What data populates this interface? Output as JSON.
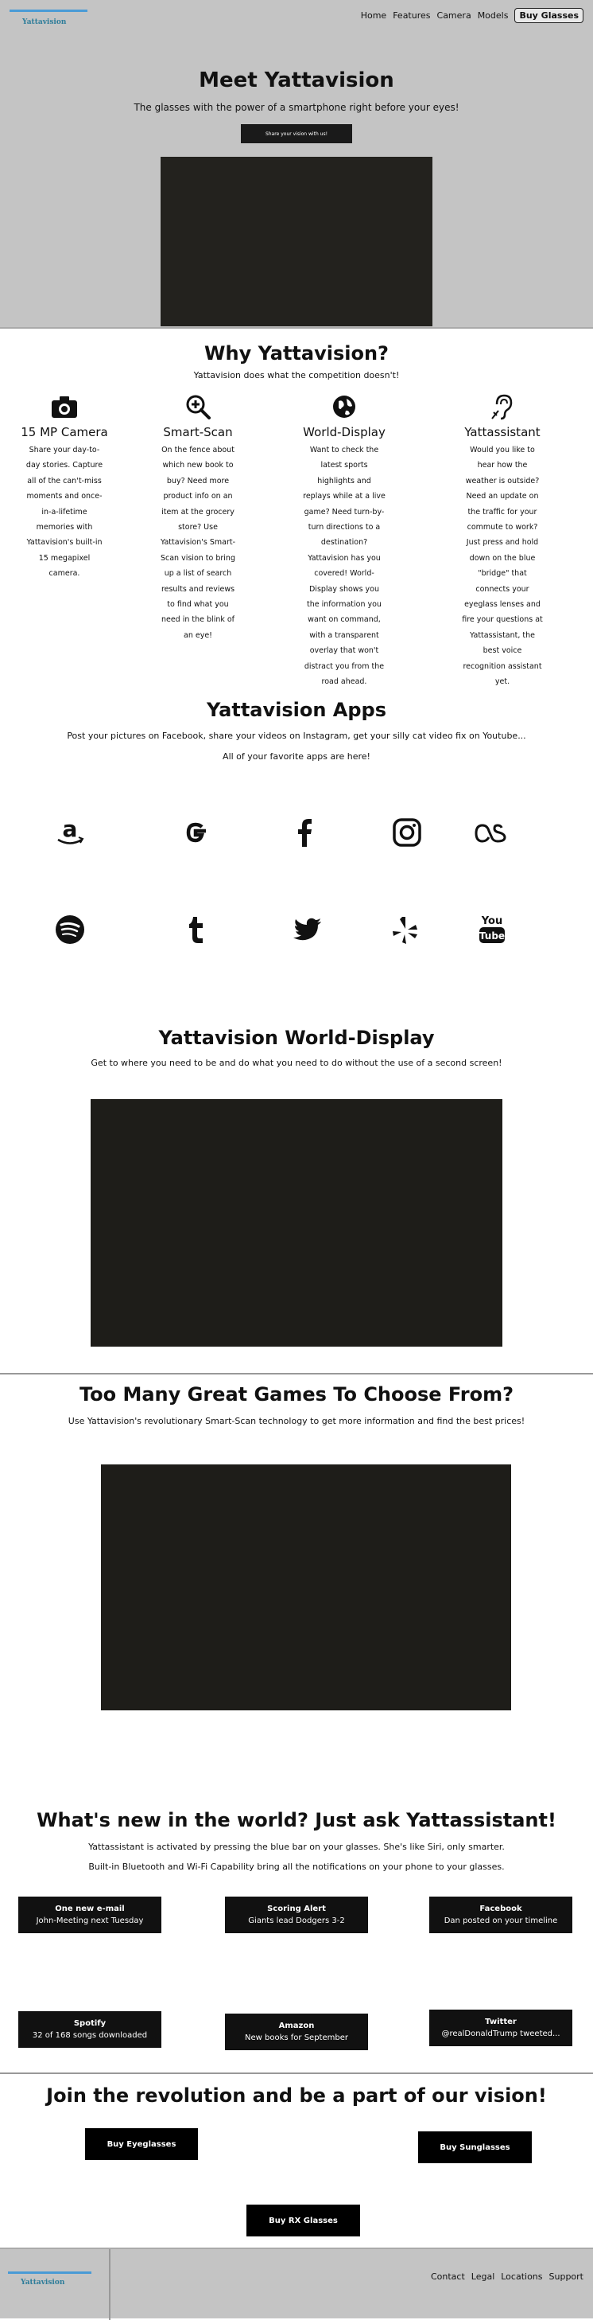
{
  "header": {
    "logo_text": "Yattavision",
    "nav": [
      "Home",
      "Features",
      "Camera",
      "Models"
    ],
    "buy_label": "Buy Glasses"
  },
  "hero": {
    "title": "Meet Yattavision",
    "subtitle": "The glasses with the power of a smartphone right before your eyes!",
    "button_label": "Share your vision with us!"
  },
  "why": {
    "title": "Why Yattavision?",
    "subtitle": "Yattavision does what the competition doesn't!",
    "features": [
      {
        "icon": "camera-icon",
        "name": "15 MP Camera",
        "desc": "Share your day-to-day stories. Capture all of the can't-miss moments and once-in-a-lifetime memories with Yattavision's built-in 15 megapixel camera."
      },
      {
        "icon": "magnifier-plus-icon",
        "name": "Smart-Scan",
        "desc": "On the fence about which new book to buy? Need more product info on an item at the grocery store? Use Yattavision's Smart-Scan vision to bring up a list of search results and reviews to find what you need in the blink of an eye!"
      },
      {
        "icon": "globe-icon",
        "name": "World-Display",
        "desc": "Want to check the latest sports highlights and replays while at a live game? Need turn-by-turn directions to a destination? Yattavision has you covered! World-Display shows you the information you want on command, with a transparent overlay that won't distract you from the road ahead."
      },
      {
        "icon": "ear-icon",
        "name": "Yattassistant",
        "desc": "Would you like to hear how the weather is outside? Need an update on the traffic for your commute to work? Just press and hold down on the blue \"bridge\" that connects your eyeglass lenses and fire your questions at Yattassistant, the best voice recognition assistant yet."
      }
    ]
  },
  "apps": {
    "title": "Yattavision Apps",
    "subtitle1": "Post your pictures on Facebook, share your videos on Instagram, get your silly cat video fix on Youtube...",
    "subtitle2": "All of your favorite apps are here!",
    "icons": [
      "amazon-icon",
      "google-icon",
      "facebook-icon",
      "instagram-icon",
      "lastfm-icon",
      "spotify-icon",
      "tumblr-icon",
      "twitter-icon",
      "yelp-icon",
      "youtube-icon"
    ]
  },
  "world_display": {
    "title": "Yattavision World-Display",
    "subtitle": "Get to where you need to be and do what you need to do without the use of a second screen!"
  },
  "games": {
    "title": "Too Many Great Games To Choose From?",
    "subtitle": "Use Yattavision's revolutionary Smart-Scan technology to get more information and find the best prices!"
  },
  "assistant": {
    "title": "What's new in the world? Just ask Yattassistant!",
    "subtitle1": "Yattassistant is activated by pressing the blue bar on your glasses. She's like Siri, only smarter.",
    "subtitle2": "Built-in Bluetooth and Wi-Fi Capability bring all the notifications on your phone to your glasses.",
    "notifications": [
      {
        "title": "One new e-mail",
        "text": "John-Meeting next Tuesday"
      },
      {
        "title": "Scoring Alert",
        "text": "Giants lead Dodgers 3-2"
      },
      {
        "title": "Facebook",
        "text": "Dan posted on your timeline"
      },
      {
        "title": "Spotify",
        "text": "32 of 168 songs downloaded"
      },
      {
        "title": "Amazon",
        "text": "New books for September"
      },
      {
        "title": "Twitter",
        "text": "@realDonaldTrump tweeted..."
      }
    ]
  },
  "join": {
    "title": "Join the revolution and be a part of our vision!",
    "buttons": [
      "Buy Eyeglasses",
      "Buy Sunglasses",
      "Buy RX Glasses"
    ]
  },
  "footer": {
    "logo_text": "Yattavision",
    "links": [
      "Contact",
      "Legal",
      "Locations",
      "Support"
    ]
  }
}
